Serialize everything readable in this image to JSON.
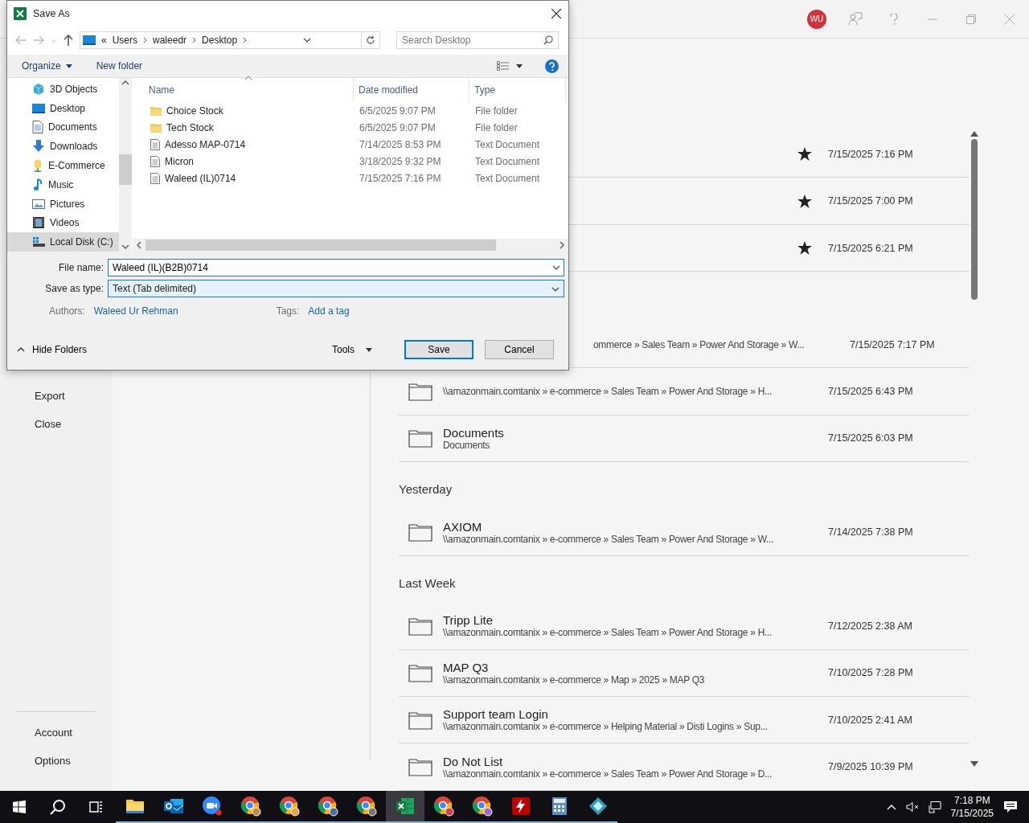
{
  "titlebar": {
    "avatar": "WU"
  },
  "backstage_nav": [
    {
      "label": "Export"
    },
    {
      "label": "Close"
    }
  ],
  "backstage_nav_bottom": [
    {
      "label": "Account"
    },
    {
      "label": "Options"
    }
  ],
  "recent_groups": [
    {
      "items": [
        {
          "pinned": true,
          "date": "7/15/2025 7:16 PM"
        },
        {
          "pinned": true,
          "date": "7/15/2025 7:00 PM"
        },
        {
          "pinned": true,
          "date": "7/15/2025 6:21 PM"
        }
      ]
    },
    {
      "items": [
        {
          "pinned": false,
          "covered": true,
          "path": "ommerce » Sales Team » Power And Storage » W...",
          "date": "7/15/2025 7:17 PM"
        },
        {
          "pinned": false,
          "path": "\\\\amazonmain.comtanix » e-commerce » Sales Team » Power And Storage » H...",
          "date": "7/15/2025 6:43 PM"
        },
        {
          "pinned": false,
          "name": "Documents",
          "path": "Documents",
          "date": "7/15/2025 6:03 PM"
        }
      ]
    },
    {
      "heading": "Yesterday",
      "items": [
        {
          "pinned": false,
          "name": "AXIOM",
          "path": "\\\\amazonmain.comtanix » e-commerce » Sales Team » Power And Storage » W...",
          "date": "7/14/2025 7:38 PM"
        }
      ]
    },
    {
      "heading": "Last Week",
      "items": [
        {
          "pinned": false,
          "name": "Tripp Lite",
          "path": "\\\\amazonmain.comtanix » e-commerce » Sales Team » Power And Storage » H...",
          "date": "7/12/2025 2:38 AM"
        },
        {
          "pinned": false,
          "name": "MAP Q3",
          "path": "\\\\amazonmain.comtanix » e-commerce » Map » 2025 » MAP Q3",
          "date": "7/10/2025 7:28 PM"
        },
        {
          "pinned": false,
          "name": "Support team Login",
          "path": "\\\\amazonmain.comtanix » e-commerce » Helping Material » Disti Logins » Sup...",
          "date": "7/10/2025 2:41 AM"
        },
        {
          "pinned": false,
          "name": "Do Not List",
          "path": "\\\\amazonmain.comtanix » e-commerce » Sales Team » Power And Storage » D...",
          "date": "7/9/2025 10:39 PM"
        }
      ]
    }
  ],
  "dialog": {
    "title": "Save As",
    "breadcrumb": {
      "overflow": "«",
      "parts": [
        "Users",
        "waleedr",
        "Desktop"
      ]
    },
    "search": {
      "placeholder": "Search Desktop"
    },
    "toolbar": {
      "organize": "Organize",
      "new_folder": "New folder"
    },
    "nav_items": [
      {
        "label": "3D Objects",
        "selected": false
      },
      {
        "label": "Desktop",
        "selected": false
      },
      {
        "label": "Documents",
        "selected": false
      },
      {
        "label": "Downloads",
        "selected": false
      },
      {
        "label": "E-Commerce",
        "selected": false
      },
      {
        "label": "Music",
        "selected": false
      },
      {
        "label": "Pictures",
        "selected": false
      },
      {
        "label": "Videos",
        "selected": false
      },
      {
        "label": "Local Disk (C:)",
        "selected": true
      }
    ],
    "columns": [
      "Name",
      "Date modified",
      "Type"
    ],
    "files": [
      {
        "kind": "folder",
        "name": "Choice Stock",
        "date": "6/5/2025 9:07 PM",
        "type": "File folder"
      },
      {
        "kind": "folder",
        "name": "Tech Stock",
        "date": "6/5/2025 9:07 PM",
        "type": "File folder"
      },
      {
        "kind": "text",
        "name": "Adesso MAP-0714",
        "date": "7/14/2025 8:53 PM",
        "type": "Text Document"
      },
      {
        "kind": "text",
        "name": "Micron",
        "date": "3/18/2025 9:32 PM",
        "type": "Text Document"
      },
      {
        "kind": "text",
        "name": "Waleed (IL)0714",
        "date": "7/15/2025 7:16 PM",
        "type": "Text Document"
      }
    ],
    "file_name": {
      "label": "File name:",
      "value": "Waleed (IL)(B2B)0714"
    },
    "save_type": {
      "label": "Save as type:",
      "value": "Text (Tab delimited)"
    },
    "authors": {
      "label": "Authors:",
      "value": "Waleed Ur Rehman"
    },
    "tags": {
      "label": "Tags:",
      "value": "Add a tag"
    },
    "hide_folders": "Hide Folders",
    "tools": "Tools",
    "save": "Save",
    "cancel": "Cancel"
  },
  "taskbar": {
    "apps": [
      {
        "running": true,
        "active": false
      },
      {
        "running": true,
        "active": false
      },
      {
        "running": true,
        "active": false
      },
      {
        "running": true,
        "active": false
      },
      {
        "running": true,
        "active": false
      },
      {
        "running": true,
        "active": false
      },
      {
        "running": true,
        "active": false
      },
      {
        "running": true,
        "active": true
      },
      {
        "running": true,
        "active": false
      },
      {
        "running": true,
        "active": false
      },
      {
        "running": true,
        "active": false
      },
      {
        "running": true,
        "active": false
      },
      {
        "running": true,
        "active": false
      }
    ],
    "time": "7:18 PM",
    "date": "7/15/2025"
  }
}
